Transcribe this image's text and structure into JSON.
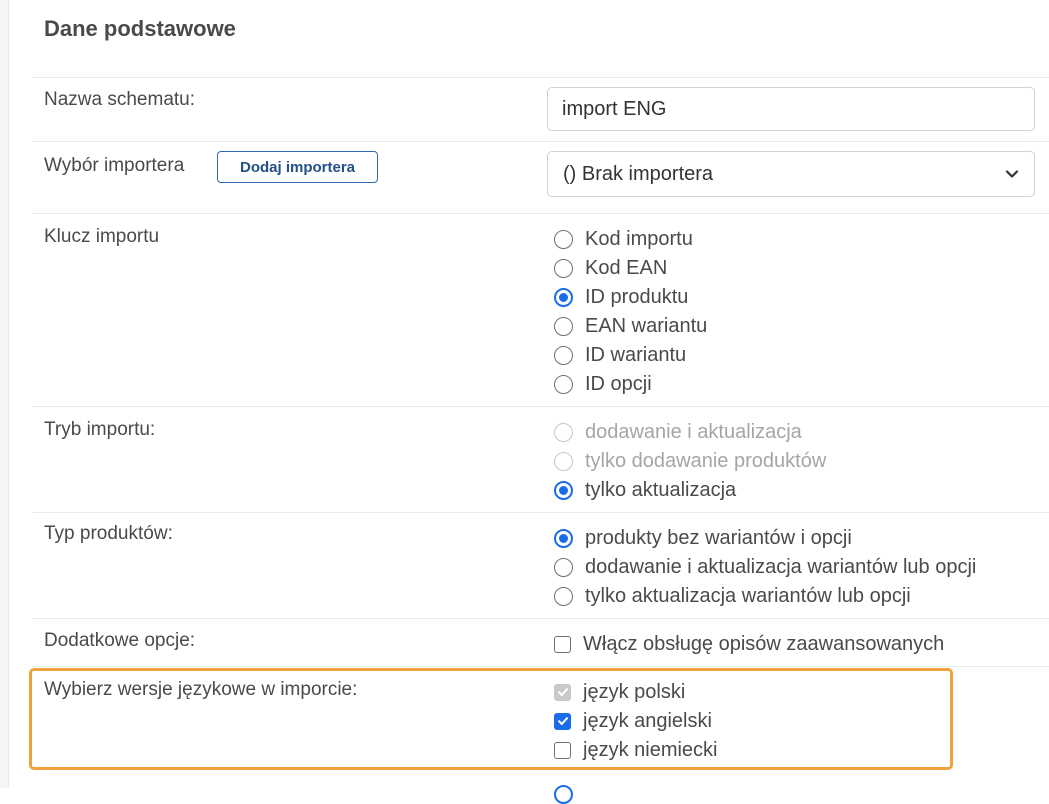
{
  "section": {
    "title": "Dane podstawowe"
  },
  "schema_name": {
    "label": "Nazwa schematu:",
    "value": "import ENG"
  },
  "importer": {
    "label": "Wybór importera",
    "add_button": "Dodaj importera",
    "selected": "() Brak importera",
    "icon": "chevron-down-icon"
  },
  "import_key": {
    "label": "Klucz importu",
    "options": [
      "Kod importu",
      "Kod EAN",
      "ID produktu",
      "EAN wariantu",
      "ID wariantu",
      "ID opcji"
    ],
    "selected": "ID produktu"
  },
  "import_mode": {
    "label": "Tryb importu:",
    "options": [
      "dodawanie i aktualizacja",
      "tylko dodawanie produktów",
      "tylko aktualizacja"
    ],
    "disabled": [
      "dodawanie i aktualizacja",
      "tylko dodawanie produktów"
    ],
    "selected": "tylko aktualizacja"
  },
  "product_type": {
    "label": "Typ produktów:",
    "options": [
      "produkty bez wariantów i opcji",
      "dodawanie i aktualizacja wariantów lub opcji",
      "tylko aktualizacja wariantów lub opcji"
    ],
    "selected": "produkty bez wariantów i opcji"
  },
  "extra_options": {
    "label": "Dodatkowe opcje:",
    "options": [
      {
        "label": "Włącz obsługę opisów zaawansowanych",
        "checked": false
      }
    ]
  },
  "languages": {
    "label": "Wybierz wersje językowe w imporcie:",
    "options": [
      {
        "label": "język polski",
        "checked": true,
        "disabled": true
      },
      {
        "label": "język angielski",
        "checked": true,
        "disabled": false
      },
      {
        "label": "język niemiecki",
        "checked": false,
        "disabled": false
      }
    ]
  },
  "colors": {
    "accent": "#1a6ce8",
    "highlight_border": "#f2a23c",
    "button_border": "#2d6ab3"
  }
}
